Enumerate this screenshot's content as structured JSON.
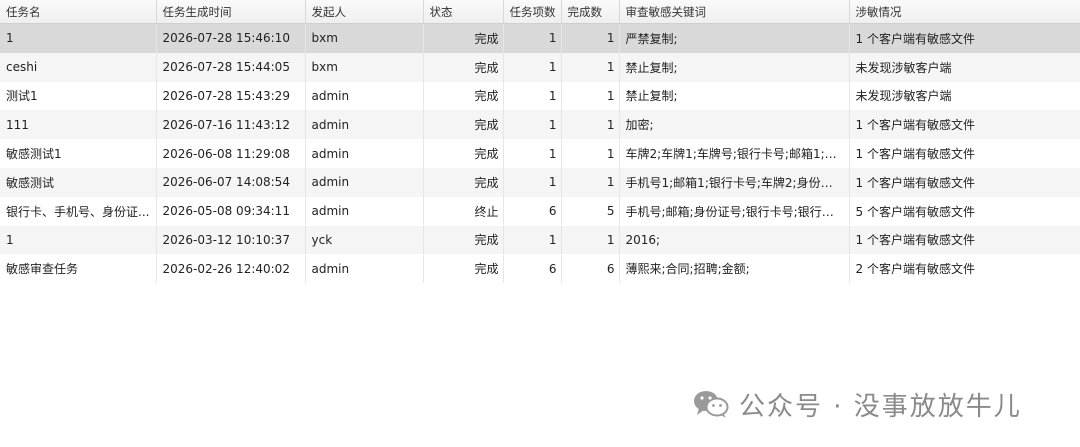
{
  "columns": [
    "任务名",
    "任务生成时间",
    "发起人",
    "状态",
    "任务项数",
    "完成数",
    "审查敏感关键词",
    "涉敏情况"
  ],
  "rows": [
    {
      "name": "1",
      "time": "2026-07-28 15:46:10",
      "initiator": "bxm",
      "status": "完成",
      "items": "1",
      "done": "1",
      "keywords": "严禁复制;",
      "result": "1 个客户端有敏感文件"
    },
    {
      "name": "ceshi",
      "time": "2026-07-28 15:44:05",
      "initiator": "bxm",
      "status": "完成",
      "items": "1",
      "done": "1",
      "keywords": "禁止复制;",
      "result": "未发现涉敏客户端"
    },
    {
      "name": "测试1",
      "time": "2026-07-28 15:43:29",
      "initiator": "admin",
      "status": "完成",
      "items": "1",
      "done": "1",
      "keywords": "禁止复制;",
      "result": "未发现涉敏客户端"
    },
    {
      "name": "111",
      "time": "2026-07-16 11:43:12",
      "initiator": "admin",
      "status": "完成",
      "items": "1",
      "done": "1",
      "keywords": "加密;",
      "result": "1 个客户端有敏感文件"
    },
    {
      "name": "敏感测试1",
      "time": "2026-06-08 11:29:08",
      "initiator": "admin",
      "status": "完成",
      "items": "1",
      "done": "1",
      "keywords": "车牌2;车牌1;车牌号;银行卡号;邮箱1;身份...",
      "result": "1 个客户端有敏感文件"
    },
    {
      "name": "敏感测试",
      "time": "2026-06-07 14:08:54",
      "initiator": "admin",
      "status": "完成",
      "items": "1",
      "done": "1",
      "keywords": "手机号1;邮箱1;银行卡号;车牌2;身份证号1;",
      "result": "1 个客户端有敏感文件"
    },
    {
      "name": "银行卡、手机号、身份证...",
      "time": "2026-05-08 09:34:11",
      "initiator": "admin",
      "status": "终止",
      "items": "6",
      "done": "5",
      "keywords": "手机号;邮箱;身份证号;银行卡号;银行卡号...",
      "result": "5 个客户端有敏感文件"
    },
    {
      "name": "1",
      "time": "2026-03-12 10:10:37",
      "initiator": "yck",
      "status": "完成",
      "items": "1",
      "done": "1",
      "keywords": "2016;",
      "result": "1 个客户端有敏感文件"
    },
    {
      "name": "敏感审查任务",
      "time": "2026-02-26 12:40:02",
      "initiator": "admin",
      "status": "完成",
      "items": "6",
      "done": "6",
      "keywords": "薄熙来;合同;招聘;金额;",
      "result": "2 个客户端有敏感文件"
    }
  ],
  "watermark": {
    "text": "公众号 · 没事放放牛儿",
    "icon": "wechat-icon",
    "color": "#8a8a8a"
  },
  "colors": {
    "selected_row": "#d9d9d9",
    "alt_row": "#f5f5f5",
    "header": "#efefef"
  }
}
